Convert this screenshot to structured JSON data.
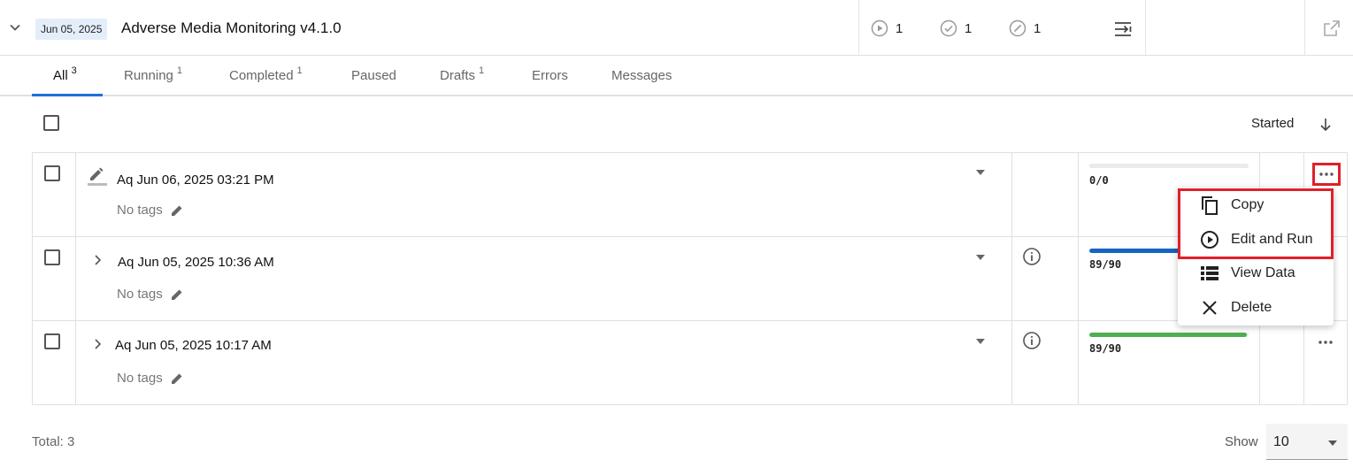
{
  "header": {
    "date": "Jun 05, 2025",
    "title": "Adverse Media Monitoring v4.1.0",
    "stats": {
      "running": "1",
      "completed": "1",
      "paused": "1"
    }
  },
  "tabs": [
    {
      "label": "All",
      "count": "3"
    },
    {
      "label": "Running",
      "count": "1"
    },
    {
      "label": "Completed",
      "count": "1"
    },
    {
      "label": "Paused",
      "count": ""
    },
    {
      "label": "Drafts",
      "count": "1"
    },
    {
      "label": "Errors",
      "count": ""
    },
    {
      "label": "Messages",
      "count": ""
    }
  ],
  "list": {
    "sort_label": "Started",
    "rows": [
      {
        "name": "Aq Jun 06, 2025 03:21 PM",
        "tags": "No tags",
        "count": "0/0",
        "progress": 0,
        "progress_color": "#eaeaea"
      },
      {
        "name": "Aq Jun 05, 2025 10:36 AM",
        "tags": "No tags",
        "count": "89/90",
        "progress": 0.989,
        "progress_color": "#1565c0"
      },
      {
        "name": "Aq Jun 05, 2025 10:17 AM",
        "tags": "No tags",
        "count": "89/90",
        "progress": 0.989,
        "progress_color": "#4caf50"
      }
    ]
  },
  "menu": {
    "items": [
      {
        "label": "Copy",
        "icon": "copy-icon"
      },
      {
        "label": "Edit and Run",
        "icon": "play-circle-icon"
      },
      {
        "label": "View Data",
        "icon": "list-icon"
      },
      {
        "label": "Delete",
        "icon": "close-icon"
      }
    ]
  },
  "footer": {
    "total": "Total: 3",
    "show_label": "Show",
    "page_size": "10"
  },
  "colors": {
    "accent": "#1e6fd9",
    "highlight": "#e0202a",
    "date_chip_bg": "#e4eefb"
  }
}
